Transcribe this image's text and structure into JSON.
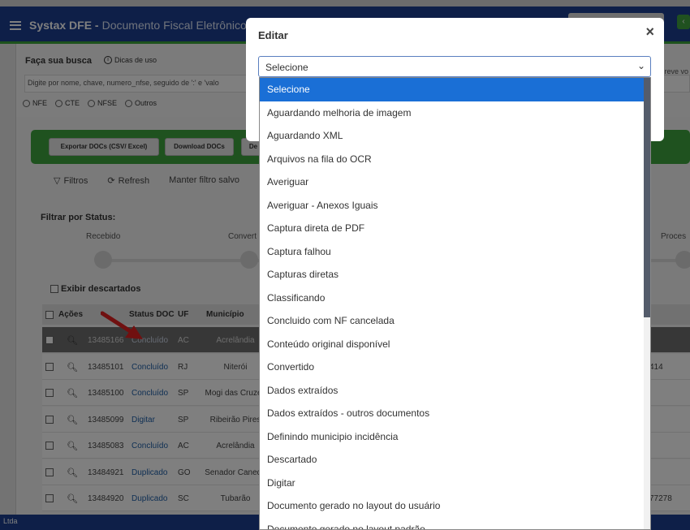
{
  "app": {
    "title": "Systax DFE -",
    "subtitle": "Documento Fiscal Eletrônico",
    "footer_text": "Ltda"
  },
  "search": {
    "label": "Faça sua busca",
    "tips": "Dicas de uso",
    "placeholder": "Digite por nome, chave, numero_nfse, seguido de ':' e 'valo",
    "right_hint": "reve vo",
    "doc_types": [
      "NFE",
      "CTE",
      "NFSE",
      "Outros"
    ]
  },
  "toolbar": {
    "export_button": "Exportar DOCs (CSV/ Excel)",
    "download_button": "Download DOCs",
    "third_button": "De",
    "filters": "Filtros",
    "refresh": "Refresh",
    "save_filter": "Manter filtro salvo"
  },
  "status_filter": {
    "label": "Filtrar por Status:",
    "steps": [
      "Recebido",
      "Convert",
      "Proces"
    ]
  },
  "discarded_label": "Exibir descartados",
  "table": {
    "headers": [
      "Ações",
      "Status DOC",
      "UF",
      "Município"
    ],
    "rows": [
      {
        "id": "13485166",
        "status": "Concluído",
        "uf": "AC",
        "city": "Acrelândia",
        "extra": "",
        "highlight": true
      },
      {
        "id": "13485101",
        "status": "Concluído",
        "uf": "RJ",
        "city": "Niterói",
        "extra": "414",
        "highlight": false
      },
      {
        "id": "13485100",
        "status": "Concluído",
        "uf": "SP",
        "city": "Mogi das Cruzes",
        "extra": "",
        "highlight": false
      },
      {
        "id": "13485099",
        "status": "Digitar",
        "uf": "SP",
        "city": "Ribeirão Pires",
        "extra": "",
        "highlight": false
      },
      {
        "id": "13485083",
        "status": "Concluído",
        "uf": "AC",
        "city": "Acrelândia",
        "extra": "",
        "highlight": false
      },
      {
        "id": "13484921",
        "status": "Duplicado",
        "uf": "GO",
        "city": "Senador Canedo",
        "extra": "",
        "highlight": false
      },
      {
        "id": "13484920",
        "status": "Duplicado",
        "uf": "SC",
        "city": "Tubarão",
        "extra": "77278",
        "highlight": false
      }
    ]
  },
  "modal": {
    "title": "Editar",
    "close": "×",
    "select_value": "Selecione"
  },
  "dropdown": {
    "options": [
      "Selecione",
      "Aguardando melhoria de imagem",
      "Aguardando XML",
      "Arquivos na fila do OCR",
      "Averiguar",
      "Averiguar - Anexos Iguais",
      "Captura direta de PDF",
      "Captura falhou",
      "Capturas diretas",
      "Classificando",
      "Concluido com NF cancelada",
      "Conteúdo original disponível",
      "Convertido",
      "Dados extraídos",
      "Dados extraídos - outros documentos",
      "Definindo municipio incidência",
      "Descartado",
      "Digitar",
      "Documento gerado no layout do usuário",
      "Documento gerado no layout padrão"
    ],
    "selected_index": 0
  },
  "colors": {
    "appbar": "#1c3f91",
    "green": "#3fa43f",
    "selected_option": "#1a6fd6",
    "link": "#2060a8",
    "arrow": "#e02020"
  }
}
